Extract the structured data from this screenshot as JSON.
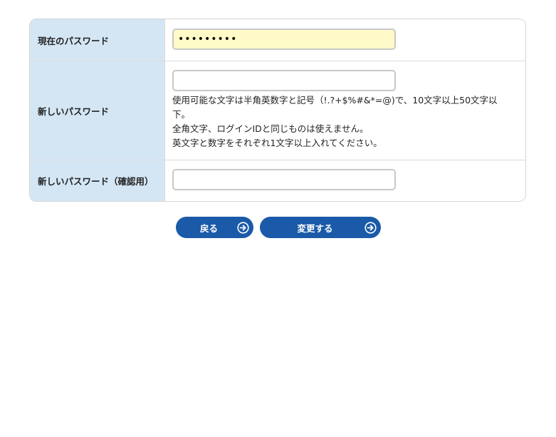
{
  "form": {
    "current_password": {
      "label": "現在のパスワード",
      "value": "123456789"
    },
    "new_password": {
      "label": "新しいパスワード",
      "value": "",
      "help_lines": [
        "使用可能な文字は半角英数字と記号（!.?+$%#&*=@)で、10文字以上50文字以",
        "下。",
        "全角文字、ログインIDと同じものは使えません。",
        "英文字と数字をそれぞれ1文字以上入れてください。"
      ]
    },
    "confirm_password": {
      "label": "新しいパスワード（確認用）",
      "value": ""
    }
  },
  "buttons": {
    "back_label": "戻る",
    "change_label": "変更する"
  },
  "icons": {
    "button_icon": "arrow-circle-right-icon"
  },
  "colors": {
    "label_background": "#d4e6f4",
    "button_background": "#1a5aa8",
    "filled_input_background": "#fffac8"
  }
}
